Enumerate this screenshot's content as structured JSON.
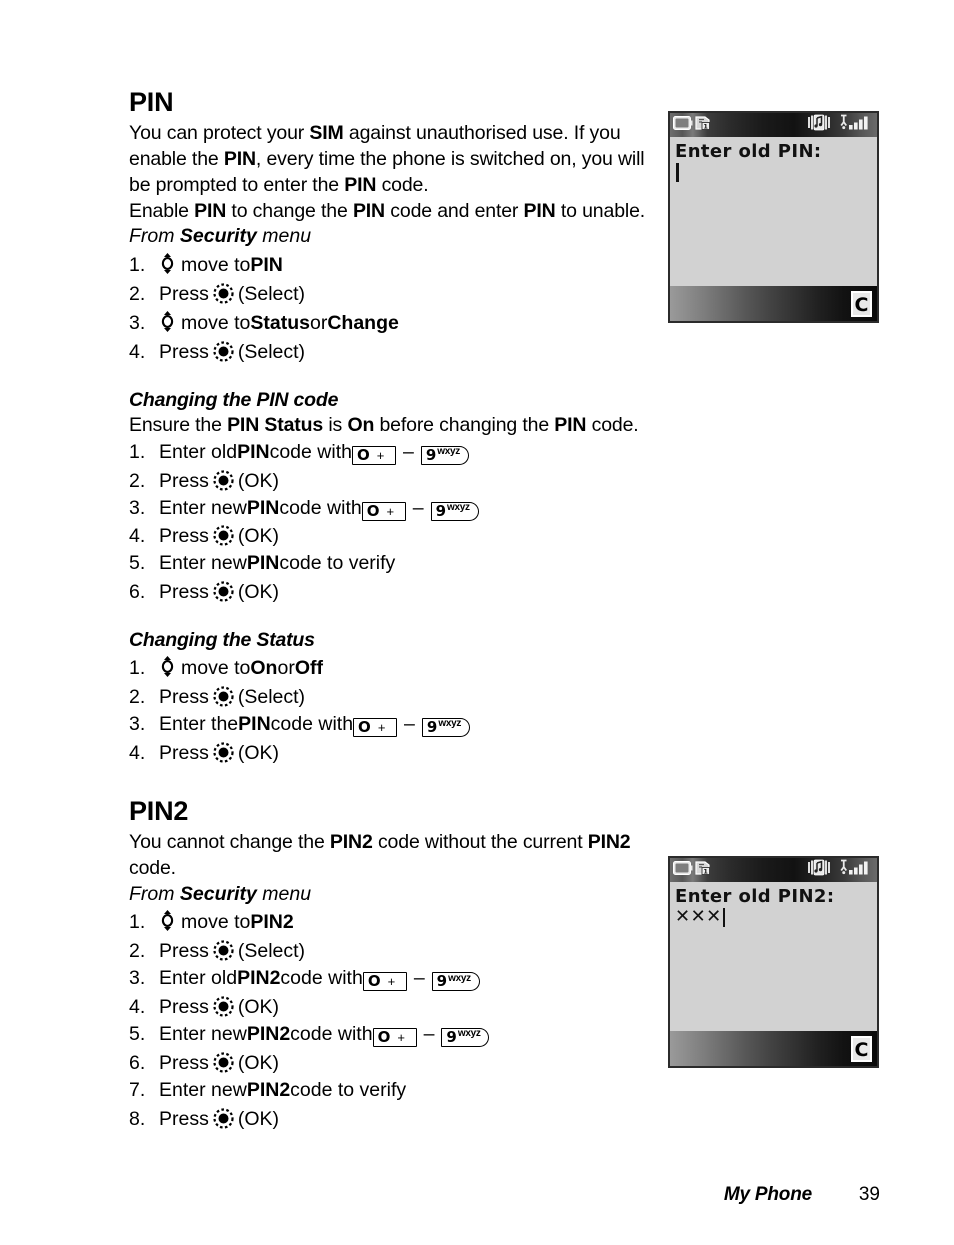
{
  "document": {
    "footer": {
      "title": "My Phone",
      "page_number": "39"
    }
  },
  "sections": {
    "pin": {
      "heading": "PIN",
      "paragraph_1": "You can protect your SIM against unauthorised use. If you enable the PIN, every time the phone is switched on, you will be prompted to enter the PIN code.",
      "paragraph_2": "Enable PIN to change the PIN code and enter PIN to unable.",
      "from_prefix": "From ",
      "from_bold": "Security",
      "from_suffix": " menu",
      "steps": [
        {
          "num": "1.",
          "pre": "",
          "icon": "updown-rocker-icon",
          "mid": "move to ",
          "bold": "PIN",
          "post": ""
        },
        {
          "num": "2.",
          "pre": "Press ",
          "icon": "select-key-icon",
          "mid": "",
          "bold": "",
          "post": "(Select)"
        },
        {
          "num": "3.",
          "pre": "",
          "icon": "updown-rocker-icon",
          "mid": "move to ",
          "bold": "Status",
          "post": " or ",
          "bold2": "Change"
        },
        {
          "num": "4.",
          "pre": "Press ",
          "icon": "select-key-icon",
          "mid": "",
          "bold": "",
          "post": "(Select)"
        }
      ]
    },
    "changing_pin_code": {
      "heading": "Changing the PIN code",
      "intro": "Ensure the PIN Status is On before changing the PIN code.",
      "steps": [
        {
          "num": "1.",
          "pre": "Enter old ",
          "bold": "PIN",
          "post": " code with ",
          "keys": true
        },
        {
          "num": "2.",
          "pre": "Press ",
          "icon": "select-key-icon",
          "post": "(OK)"
        },
        {
          "num": "3.",
          "pre": "Enter new ",
          "bold": "PIN",
          "post": " code with ",
          "keys": true
        },
        {
          "num": "4.",
          "pre": "Press ",
          "icon": "select-key-icon",
          "post": "(OK)"
        },
        {
          "num": "5.",
          "pre": "Enter new ",
          "bold": "PIN",
          "post": " code to verify",
          "keys": false
        },
        {
          "num": "6.",
          "pre": "Press ",
          "icon": "select-key-icon",
          "post": "(OK)"
        }
      ]
    },
    "changing_status": {
      "heading": "Changing the Status",
      "steps": [
        {
          "num": "1.",
          "icon": "updown-rocker-icon",
          "mid": "move to ",
          "bold": "On",
          "post": " or ",
          "bold2": "Off"
        },
        {
          "num": "2.",
          "pre": "Press ",
          "icon": "select-key-icon",
          "post": "(Select)"
        },
        {
          "num": "3.",
          "pre": "Enter the ",
          "bold": "PIN",
          "post": " code with ",
          "keys": true
        },
        {
          "num": "4.",
          "pre": "Press ",
          "icon": "select-key-icon",
          "post": "(OK)"
        }
      ]
    },
    "pin2": {
      "heading": "PIN2",
      "paragraph_1": "You cannot change the PIN2 code without the current PIN2 code.",
      "from_prefix": "From ",
      "from_bold": "Security",
      "from_suffix": " menu",
      "steps": [
        {
          "num": "1.",
          "icon": "updown-rocker-icon",
          "mid": "move to ",
          "bold": "PIN2"
        },
        {
          "num": "2.",
          "pre": "Press ",
          "icon": "select-key-icon",
          "post": "(Select)"
        },
        {
          "num": "3.",
          "pre": "Enter old ",
          "bold": "PIN2",
          "post": " code with ",
          "keys": true
        },
        {
          "num": "4.",
          "pre": "Press ",
          "icon": "select-key-icon",
          "post": "(OK)"
        },
        {
          "num": "5.",
          "pre": "Enter new ",
          "bold": "PIN2",
          "post": " code with ",
          "keys": true
        },
        {
          "num": "6.",
          "pre": "Press ",
          "icon": "select-key-icon",
          "post": "(OK)"
        },
        {
          "num": "7.",
          "pre": "Enter new ",
          "bold": "PIN2",
          "post": " code to verify",
          "keys": false
        },
        {
          "num": "8.",
          "pre": "Press ",
          "icon": "select-key-icon",
          "post": "(OK)"
        }
      ]
    }
  },
  "keycaps": {
    "zero": {
      "digit": "O",
      "sub": "+"
    },
    "nine": {
      "digit": "9",
      "sub": "wxyz"
    },
    "range_dash": "–"
  },
  "text_fragments": {
    "p1_a": "You can protect your ",
    "p1_sim": "SIM",
    "p1_b": " against unauthorised use. If you enable the ",
    "p1_pin": "PIN",
    "p1_c": ", every time the phone is switched on, you will be prompted to enter the ",
    "p1_pin2": "PIN",
    "p1_d": " code.",
    "p2_a": "Enable ",
    "p2_pin1": "PIN",
    "p2_b": " to change the ",
    "p2_pin2": "PIN",
    "p2_c": " code and enter ",
    "p2_pin3": "PIN",
    "p2_d": " to unable.",
    "intro_a": "Ensure the ",
    "intro_b": "PIN Status",
    "intro_c": " is ",
    "intro_d": "On",
    "intro_e": " before changing the ",
    "intro_f": "PIN",
    "intro_g": " code.",
    "pin2_p_a": "You cannot change the ",
    "pin2_p_b": "PIN2",
    "pin2_p_c": " code without the current ",
    "pin2_p_d": "PIN2",
    "pin2_p_e": " code.",
    "move_to": "move to ",
    "press": "Press ",
    "select_label": "(Select)",
    "ok_label": "(OK)",
    "or": " or ",
    "code_with": " code with ",
    "code_verify": " code to verify",
    "enter_old": "Enter old ",
    "enter_new": "Enter new ",
    "enter_the": "Enter the "
  },
  "phone_screens": {
    "pin": {
      "name": "enter-old-pin-screen",
      "prompt": "Enter old PIN:",
      "entry_value": "",
      "softkey_right": "C",
      "status_icons": [
        "battery-icon",
        "network-roaming-1-icon",
        "ringtone-vibrate-icon",
        "signal-strength-icon"
      ]
    },
    "pin2": {
      "name": "enter-old-pin2-screen",
      "prompt": "Enter old PIN2:",
      "entry_value": "✕✕✕",
      "softkey_right": "C",
      "status_icons": [
        "battery-icon",
        "network-roaming-1-icon",
        "ringtone-vibrate-icon",
        "signal-strength-icon"
      ]
    }
  },
  "colors": {
    "screen_bg": "#d2d2d2",
    "screen_border": "#2b2b2b",
    "text": "#000000",
    "page_bg": "#ffffff"
  }
}
